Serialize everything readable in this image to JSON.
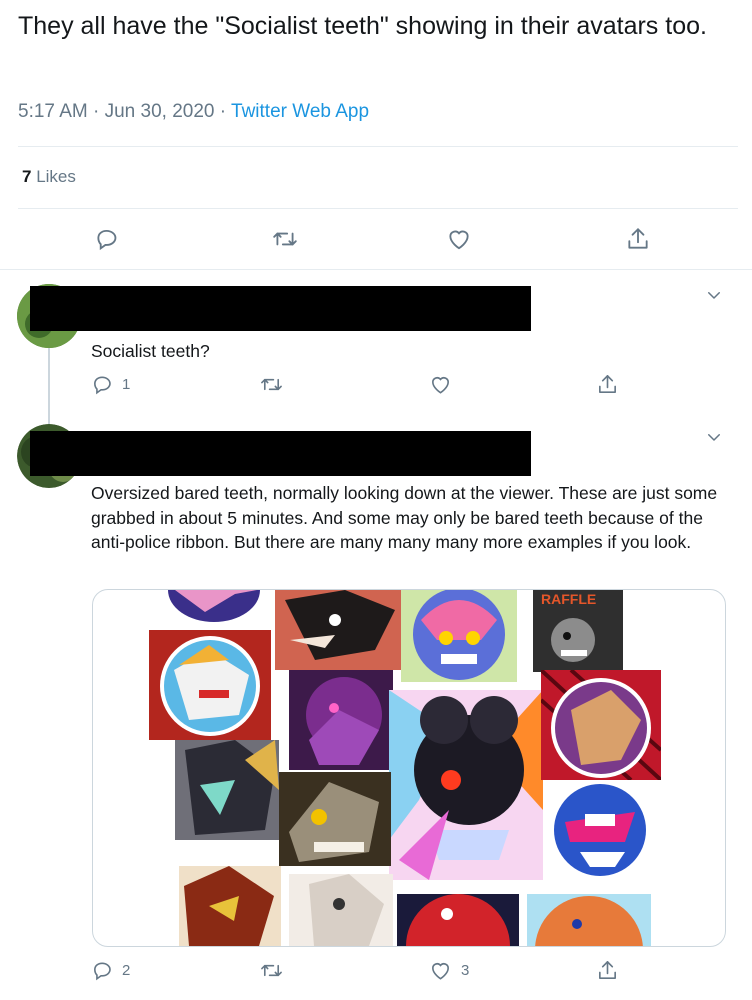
{
  "tweet": {
    "text": "They all have the \"Socialist teeth\" showing in their avatars too.",
    "time": "5:17 AM",
    "separator": "·",
    "date": "Jun 30, 2020",
    "app": "Twitter Web App",
    "likes_count": "7",
    "likes_label": "Likes"
  },
  "replies": [
    {
      "text": "Socialist teeth?",
      "reply_count": "1",
      "retweet_count": "",
      "like_count": ""
    },
    {
      "text": "Oversized bared teeth, normally looking down at the viewer.  These are just some grabbed in about 5 minutes. And some may only be bared teeth because of the anti-police ribbon. But there are many many many more examples if you look.",
      "reply_count": "2",
      "retweet_count": "",
      "like_count": "3",
      "media_text": "RAFFLE"
    }
  ],
  "icons": {
    "reply": "reply-icon",
    "retweet": "retweet-icon",
    "like": "heart-icon",
    "share": "share-icon",
    "chevron": "chevron-down-icon"
  },
  "colors": {
    "icon_gray": "#657786",
    "link_blue": "#1b95e0",
    "divider": "#e6ecf0"
  }
}
